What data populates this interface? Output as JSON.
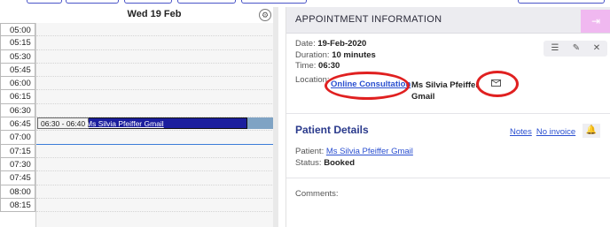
{
  "calendar": {
    "day_title": "Wed 19 Feb",
    "times": [
      "05:00",
      "05:15",
      "05:30",
      "05:45",
      "06:00",
      "06:15",
      "06:30",
      "06:45",
      "07:00",
      "07:15",
      "07:30",
      "07:45",
      "08:00",
      "08:15"
    ],
    "appointment": {
      "time_label": "06:30 - 06:40",
      "patient_label": "Ms Silvia Pfeiffer Gmail"
    }
  },
  "panel": {
    "title": "APPOINTMENT INFORMATION",
    "date_label": "Date:",
    "date_value": "19-Feb-2020",
    "duration_label": "Duration:",
    "duration_value": "10 minutes",
    "time_label": "Time:",
    "time_value": "06:30",
    "location_label": "Location:",
    "location_link": "Online Consultation",
    "location_name": "Ms Silvia Pfeiffer Gmail",
    "toolbar_icons": [
      "list-icon",
      "pencil-icon",
      "close-icon"
    ]
  },
  "patient": {
    "title": "Patient Details",
    "notes_link": "Notes",
    "invoice_link": "No invoice",
    "patient_label": "Patient:",
    "patient_value": "Ms Silvia Pfeiffer Gmail",
    "status_label": "Status:",
    "status_value": "Booked",
    "comments_label": "Comments:"
  },
  "colors": {
    "appointment": "#1c1f9e",
    "accent_pink": "#f0b8f0",
    "highlight_ring": "#e02020",
    "link": "#2a4fd0"
  }
}
